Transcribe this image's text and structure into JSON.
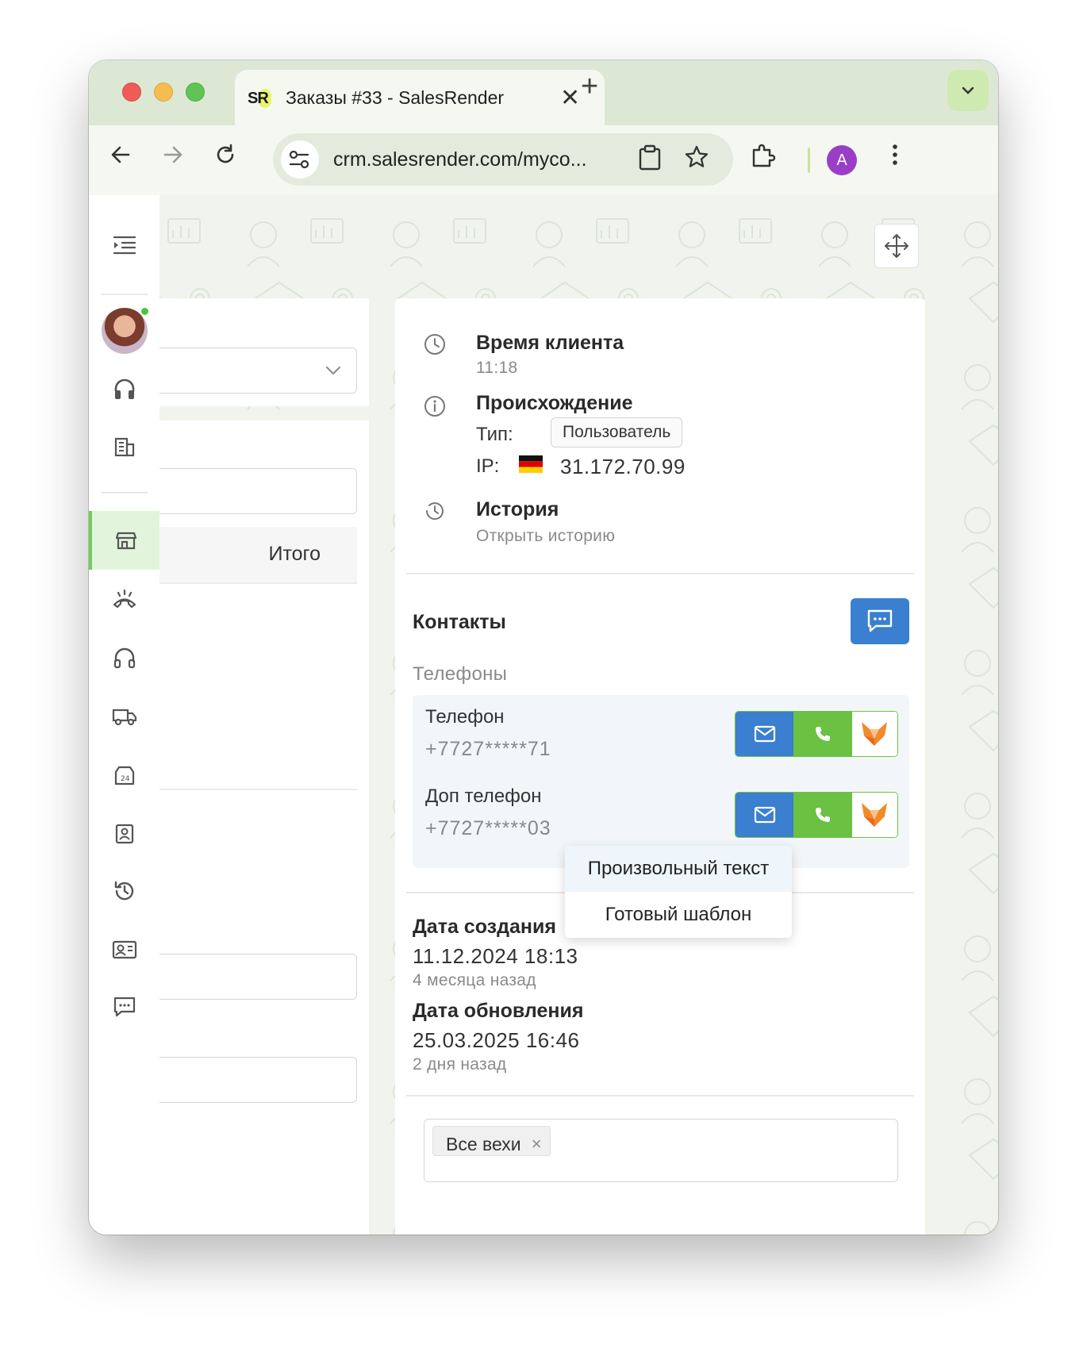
{
  "browser": {
    "tab": {
      "favicon": "SR",
      "title": "Заказы #33 - SalesRender",
      "close": "✕"
    },
    "new_tab": "+",
    "url": "crm.salesrender.com/myco...",
    "profile_initial": "A"
  },
  "left_panel": {
    "total_label": "Итого"
  },
  "client_info": {
    "time": {
      "title": "Время клиента",
      "value": "11:18"
    },
    "origin": {
      "title": "Происхождение",
      "type_label": "Тип:",
      "type_value": "Пользователь",
      "ip_label": "IP:",
      "ip_value": "31.172.70.99"
    },
    "history": {
      "title": "История",
      "link": "Открыть историю"
    }
  },
  "contacts": {
    "title": "Контакты",
    "phones_label": "Телефоны",
    "phones": [
      {
        "name": "Телефон",
        "number": "+7727*****71"
      },
      {
        "name": "Доп телефон",
        "number": "+7727*****03"
      }
    ],
    "message_menu": [
      "Произвольный текст",
      "Готовый шаблон"
    ]
  },
  "dates": {
    "created_title": "Дата создания",
    "created_value": "11.12.2024 18:13",
    "created_ago": "4 месяца назад",
    "updated_title": "Дата обновления",
    "updated_value": "25.03.2025 16:46",
    "updated_ago": "2 дня назад"
  },
  "milestones": {
    "tag": "Все вехи",
    "remove": "×"
  },
  "colors": {
    "accent_blue": "#3a7fd0",
    "accent_green": "#6ac142",
    "active_nav": "#e2f5dc"
  }
}
